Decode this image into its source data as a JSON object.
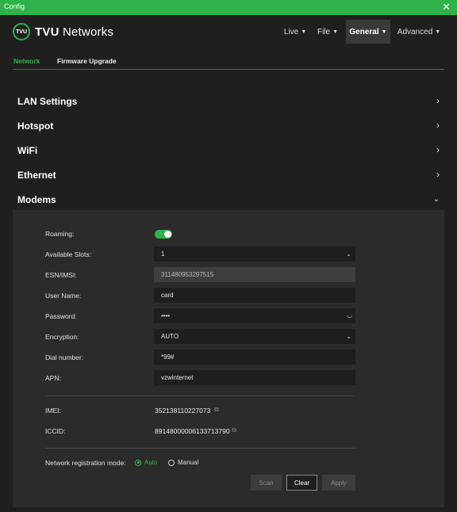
{
  "window": {
    "title": "Config",
    "close_glyph": "✕"
  },
  "brand": {
    "badge": "TVU",
    "name_bold": "TVU",
    "name_rest": "Networks"
  },
  "menu": [
    {
      "label": "Live",
      "active": false
    },
    {
      "label": "File",
      "active": false
    },
    {
      "label": "General",
      "active": true
    },
    {
      "label": "Advanced",
      "active": false
    }
  ],
  "tabs": [
    {
      "label": "Network",
      "active": true
    },
    {
      "label": "Firmware Upgrade",
      "active": false
    }
  ],
  "sections": [
    {
      "label": "LAN Settings",
      "expanded": false
    },
    {
      "label": "Hotspot",
      "expanded": false
    },
    {
      "label": "WiFi",
      "expanded": false
    },
    {
      "label": "Ethernet",
      "expanded": false
    },
    {
      "label": "Modems",
      "expanded": true
    }
  ],
  "modems": {
    "roaming": {
      "label": "Roaming:",
      "enabled": true
    },
    "available_slots": {
      "label": "Available Slots:",
      "value": "1"
    },
    "esn_imsi": {
      "label": "ESN/IMSI:",
      "value": "311480953297515"
    },
    "user_name": {
      "label": "User Name:",
      "value": "card"
    },
    "password": {
      "label": "Password:",
      "value": "••••"
    },
    "encryption": {
      "label": "Encryption:",
      "value": "AUTO"
    },
    "dial_number": {
      "label": "Dial number:",
      "value": "*99#"
    },
    "apn": {
      "label": "APN:",
      "value": "vzwinternet"
    },
    "imei": {
      "label": "IMEI:",
      "value": "352138110227073"
    },
    "iccid": {
      "label": "ICCID:",
      "value": "89148000006133713790"
    },
    "registration": {
      "label": "Network registration mode:",
      "options": [
        {
          "label": "Auto",
          "selected": true
        },
        {
          "label": "Manual",
          "selected": false
        }
      ]
    },
    "buttons": {
      "scan": "Scan",
      "clear": "Clear",
      "apply": "Apply"
    }
  },
  "colors": {
    "accent": "#2fb24a",
    "background": "#1f1f1f",
    "panel": "#2b2b2b"
  },
  "icons": {
    "dropdown": "chevron-down-icon",
    "expand": "chevron-right-icon",
    "copy": "copy-icon",
    "eye": "eye-closed-icon"
  }
}
